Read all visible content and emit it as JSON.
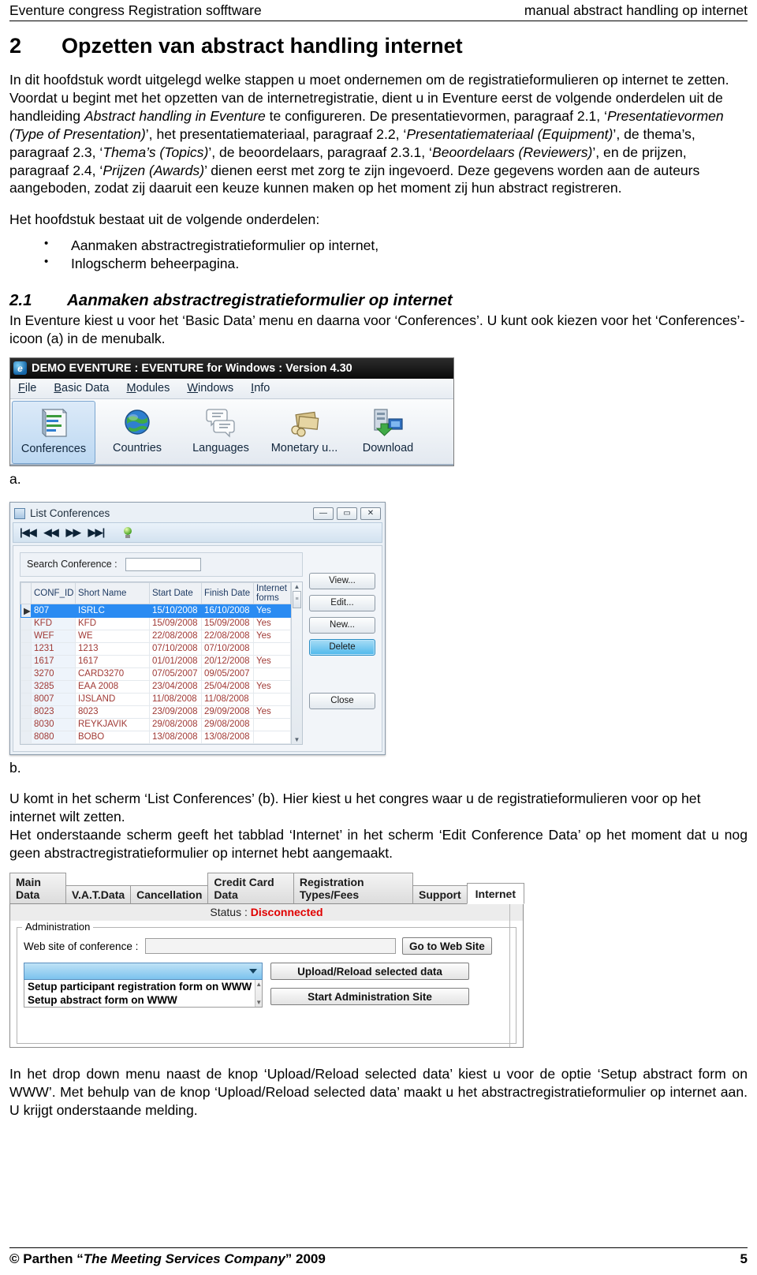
{
  "running_head": {
    "left": "Eventure congress Registration sofftware",
    "right": "manual abstract handling op internet"
  },
  "chapter": {
    "number": "2",
    "title": "Opzetten van abstract handling internet"
  },
  "intro": {
    "p1": "In dit hoofdstuk wordt uitgelegd welke stappen u moet ondernemen om de registratieformulieren op internet te zetten.",
    "p2_a": "Voordat u begint met het opzetten van de internetregistratie, dient u in Eventure eerst de volgende onderdelen uit de handleiding ",
    "p2_i1": "Abstract handling in Eventure",
    "p2_b": " te configureren. De presentatievormen, paragraaf 2.1, ‘",
    "p2_i2": "Presentatievormen (Type of Presentation)",
    "p2_c": "’, het presentatiemateriaal, paragraaf 2.2, ‘",
    "p2_i3": "Presentatiemateriaal (Equipment)",
    "p2_d": "’, de thema’s, paragraaf 2.3, ‘",
    "p2_i4": "Thema’s (Topics)",
    "p2_e": "’, de beoordelaars, paragraaf 2.3.1, ‘",
    "p2_i5": "Beoordelaars (Reviewers)",
    "p2_f": "’, en de prijzen, paragraaf 2.4, ‘",
    "p2_i6": "Prijzen (Awards)",
    "p2_g": "’ dienen eerst met zorg te zijn ingevoerd. Deze gegevens worden aan de auteurs aangeboden, zodat zij daaruit een keuze kunnen maken op het moment zij hun abstract registreren.",
    "p3": "Het hoofdstuk bestaat uit de volgende onderdelen:",
    "bullets": [
      "Aanmaken abstractregistratieformulier op internet,",
      "Inlogscherm beheerpagina."
    ]
  },
  "section21": {
    "number": "2.1",
    "title": "Aanmaken abstractregistratieformulier op internet",
    "body": "In Eventure kiest u voor het ‘Basic Data’ menu en daarna voor ‘Conferences’. U kunt ook kiezen voor het ‘Conferences’-icoon (a) in de menubalk."
  },
  "figure_a": {
    "label": "a.",
    "title": "DEMO EVENTURE : EVENTURE for Windows : Version 4.30",
    "logo_icon": "eventure-logo-icon",
    "menu": [
      "File",
      "Basic Data",
      "Modules",
      "Windows",
      "Info"
    ],
    "buttons": [
      {
        "label": "Conferences",
        "icon": "conferences-book-icon",
        "selected": true
      },
      {
        "label": "Countries",
        "icon": "globe-icon",
        "selected": false
      },
      {
        "label": "Languages",
        "icon": "speech-bubbles-icon",
        "selected": false
      },
      {
        "label": "Monetary u...",
        "icon": "money-icon",
        "selected": false
      },
      {
        "label": "Download",
        "icon": "download-icon",
        "selected": false
      }
    ]
  },
  "figure_b": {
    "label": "b.",
    "title": "List Conferences",
    "title_icon": "window-icon",
    "window_buttons": [
      "—",
      "▭",
      "✕"
    ],
    "nav_icons": [
      "first-record-icon",
      "previous-record-icon",
      "next-record-icon",
      "last-record-icon",
      "hint-bulb-icon"
    ],
    "search_label": "Search Conference :",
    "search_value": "",
    "columns": [
      "CONF_ID",
      "Short Name",
      "Start Date",
      "Finish Date",
      "Internet forms"
    ],
    "rows": [
      {
        "marker": "▶",
        "selected": true,
        "cells": [
          "807",
          "ISRLC",
          "15/10/2008",
          "16/10/2008",
          "Yes"
        ]
      },
      {
        "marker": "",
        "selected": false,
        "cells": [
          "KFD",
          "KFD",
          "15/09/2008",
          "15/09/2008",
          "Yes"
        ]
      },
      {
        "marker": "",
        "selected": false,
        "cells": [
          "WEF",
          "WE",
          "22/08/2008",
          "22/08/2008",
          "Yes"
        ]
      },
      {
        "marker": "",
        "selected": false,
        "cells": [
          "1231",
          "1213",
          "07/10/2008",
          "07/10/2008",
          ""
        ]
      },
      {
        "marker": "",
        "selected": false,
        "cells": [
          "1617",
          "1617",
          "01/01/2008",
          "20/12/2008",
          "Yes"
        ]
      },
      {
        "marker": "",
        "selected": false,
        "cells": [
          "3270",
          "CARD3270",
          "07/05/2007",
          "09/05/2007",
          ""
        ]
      },
      {
        "marker": "",
        "selected": false,
        "cells": [
          "3285",
          "EAA 2008",
          "23/04/2008",
          "25/04/2008",
          "Yes"
        ]
      },
      {
        "marker": "",
        "selected": false,
        "cells": [
          "8007",
          "IJSLAND",
          "11/08/2008",
          "11/08/2008",
          ""
        ]
      },
      {
        "marker": "",
        "selected": false,
        "cells": [
          "8023",
          "8023",
          "23/09/2008",
          "29/09/2008",
          "Yes"
        ]
      },
      {
        "marker": "",
        "selected": false,
        "cells": [
          "8030",
          "REYKJAVIK",
          "29/08/2008",
          "29/08/2008",
          ""
        ]
      },
      {
        "marker": "",
        "selected": false,
        "cells": [
          "8080",
          "BOBO",
          "13/08/2008",
          "13/08/2008",
          ""
        ]
      }
    ],
    "buttons": [
      {
        "label": "View...",
        "highlighted": false
      },
      {
        "label": "Edit...",
        "highlighted": false
      },
      {
        "label": "New...",
        "highlighted": false
      },
      {
        "label": "Delete",
        "highlighted": true
      },
      {
        "label": "Close",
        "highlighted": false
      }
    ]
  },
  "mid_text": {
    "p1": "U komt in het scherm ‘List Conferences’ (b). Hier kiest u het congres waar u de registratieformulieren voor op het internet wilt zetten.",
    "p2": "Het onderstaande scherm geeft het tabblad ‘Internet’ in het scherm ‘Edit Conference Data’ op het moment dat u nog geen abstractregistratieformulier op internet hebt aangemaakt."
  },
  "figure_c": {
    "tabs": [
      {
        "label": "Main Data",
        "active": false
      },
      {
        "label": "V.A.T.Data",
        "active": false
      },
      {
        "label": "Cancellation",
        "active": false
      },
      {
        "label": "Credit Card Data",
        "active": false
      },
      {
        "label": "Registration Types/Fees",
        "active": false
      },
      {
        "label": "Support",
        "active": false
      },
      {
        "label": "Internet",
        "active": true
      }
    ],
    "status_label": "Status :",
    "status_value": "Disconnected",
    "status_color": "#e00000",
    "group_legend": "Administration",
    "website_label": "Web site of conference :",
    "website_value": "",
    "goto_button": "Go to Web Site",
    "combo_selected": "",
    "combo_options": [
      "Setup participant registration form on WWW",
      "Setup abstract form on WWW"
    ],
    "upload_button": "Upload/Reload selected data",
    "admin_button": "Start Administration Site"
  },
  "end_text": {
    "p1": "In het drop down menu naast de knop ‘Upload/Reload selected data’ kiest u voor de optie ‘Setup abstract form on WWW’. Met behulp van de knop ‘Upload/Reload selected data’ maakt u het abstractregistratieformulier op internet aan. U krijgt onderstaande melding."
  },
  "footer": {
    "prefix": "© Parthen “",
    "quoted": "The Meeting Services Company",
    "suffix": "” 2009",
    "page": "5"
  }
}
